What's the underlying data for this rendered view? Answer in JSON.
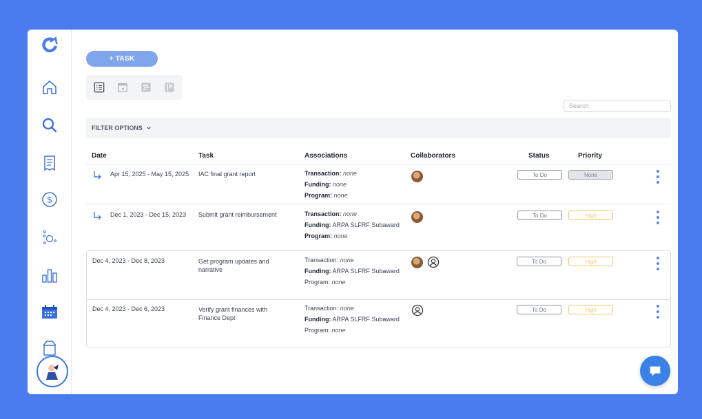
{
  "toolbar": {
    "add_task_label": "+ TASK"
  },
  "search": {
    "placeholder": "Search"
  },
  "filter": {
    "label": "FILTER OPTIONS"
  },
  "table": {
    "headers": {
      "date": "Date",
      "task": "Task",
      "associations": "Associations",
      "collaborators": "Collaborators",
      "status": "Status",
      "priority": "Priority"
    },
    "labels": {
      "transaction": "Transaction:",
      "funding": "Funding:",
      "program": "Program:"
    },
    "rows": [
      {
        "date": "Apr 15, 2025 - May 15, 2025",
        "task": "IAC final grant report",
        "transaction": "none",
        "funding": "none",
        "program": "none",
        "status": "To Do",
        "priority": "None"
      },
      {
        "date": "Dec 1, 2023 - Dec 15, 2023",
        "task": "Submit grant reimbursement",
        "transaction": "none",
        "funding": "ARPA SLFRF Subaward",
        "program": "none",
        "status": "To Do",
        "priority": "High"
      },
      {
        "date": "Dec 4, 2023 - Dec 8, 2023",
        "task": "Get program updates and narrative",
        "transaction": "none",
        "funding": "ARPA SLFRF Subaward",
        "program": "none",
        "status": "To Do",
        "priority": "High"
      },
      {
        "date": "Dec 4, 2023 - Dec 6, 2023",
        "task": "Verify grant finances with Finance Dept",
        "transaction": "none",
        "funding": "ARPA SLFRF Subaward",
        "program": "none",
        "status": "To Do",
        "priority": "High"
      }
    ]
  },
  "colors": {
    "accent": "#4a7cf0",
    "button": "#7fa5ec",
    "high": "#f2c66a",
    "kebab": "#5b86e6"
  },
  "icons": {
    "sidebar": [
      "logo-icon",
      "home-icon",
      "search-icon",
      "receipt-icon",
      "dollar-icon",
      "network-icon",
      "bar-chart-icon",
      "calendar-icon",
      "box-icon"
    ],
    "views": [
      "list-view-icon",
      "calendar-view-icon",
      "gantt-view-icon",
      "board-view-icon"
    ]
  }
}
